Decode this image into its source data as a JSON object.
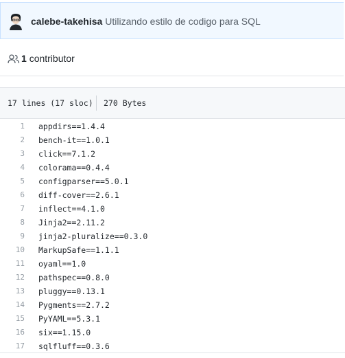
{
  "commit": {
    "author": "calebe-takehisa",
    "message": "Utilizando estilo de codigo para SQL",
    "avatar_icon": "user-avatar"
  },
  "contributors": {
    "icon": "people-icon",
    "count": "1",
    "label": "contributor"
  },
  "file_info": {
    "lines": "17 lines (17 sloc)",
    "size": "270 Bytes"
  },
  "code_lines": [
    {
      "num": "1",
      "text": "appdirs==1.4.4"
    },
    {
      "num": "2",
      "text": "bench-it==1.0.1"
    },
    {
      "num": "3",
      "text": "click==7.1.2"
    },
    {
      "num": "4",
      "text": "colorama==0.4.4"
    },
    {
      "num": "5",
      "text": "configparser==5.0.1"
    },
    {
      "num": "6",
      "text": "diff-cover==2.6.1"
    },
    {
      "num": "7",
      "text": "inflect==4.1.0"
    },
    {
      "num": "8",
      "text": "Jinja2==2.11.2"
    },
    {
      "num": "9",
      "text": "jinja2-pluralize==0.3.0"
    },
    {
      "num": "10",
      "text": "MarkupSafe==1.1.1"
    },
    {
      "num": "11",
      "text": "oyaml==1.0"
    },
    {
      "num": "12",
      "text": "pathspec==0.8.0"
    },
    {
      "num": "13",
      "text": "pluggy==0.13.1"
    },
    {
      "num": "14",
      "text": "Pygments==2.7.2"
    },
    {
      "num": "15",
      "text": "PyYAML==5.3.1"
    },
    {
      "num": "16",
      "text": "six==1.15.0"
    },
    {
      "num": "17",
      "text": "sqlfluff==0.3.6"
    }
  ]
}
